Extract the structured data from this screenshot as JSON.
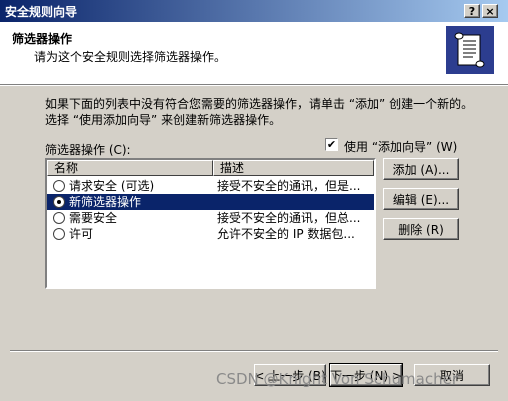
{
  "window": {
    "title": "安全规则向导",
    "help_glyph": "?",
    "close_glyph": "×"
  },
  "header": {
    "title": "筛选器操作",
    "subtitle": "请为这个安全规则选择筛选器操作。",
    "icon": "scroll-document-icon"
  },
  "intro": {
    "line1": "如果下面的列表中没有符合您需要的筛选器操作，请单击 “添加” 创建一个新的。",
    "line2": "选择 “使用添加向导” 来创建新筛选器操作。"
  },
  "filter_actions": {
    "label": "筛选器操作 (C):",
    "use_wizard": {
      "label": "使用 “添加向导” (W)",
      "checked": true
    },
    "columns": [
      "名称",
      "描述"
    ],
    "rows": [
      {
        "name": "请求安全 (可选)",
        "description": "接受不安全的通讯，但是...",
        "selected": false
      },
      {
        "name": "新筛选器操作",
        "description": "",
        "selected": true
      },
      {
        "name": "需要安全",
        "description": "接受不安全的通讯，但总...",
        "selected": false
      },
      {
        "name": "许可",
        "description": "允许不安全的 IP 数据包...",
        "selected": false
      }
    ]
  },
  "buttons": {
    "add": "添加 (A)...",
    "edit": "编辑 (E)...",
    "delete": "删除 (R)"
  },
  "footer": {
    "back": "< 上一步 (B)",
    "next": "下一步 (N) >",
    "cancel": "取消"
  },
  "watermark": "CSDN @Knight Von Schumacher",
  "colors": {
    "selection": "#0a246a",
    "dialog": "#d4d0c8",
    "titlebar_start": "#0a246a",
    "titlebar_end": "#a6caf0"
  }
}
